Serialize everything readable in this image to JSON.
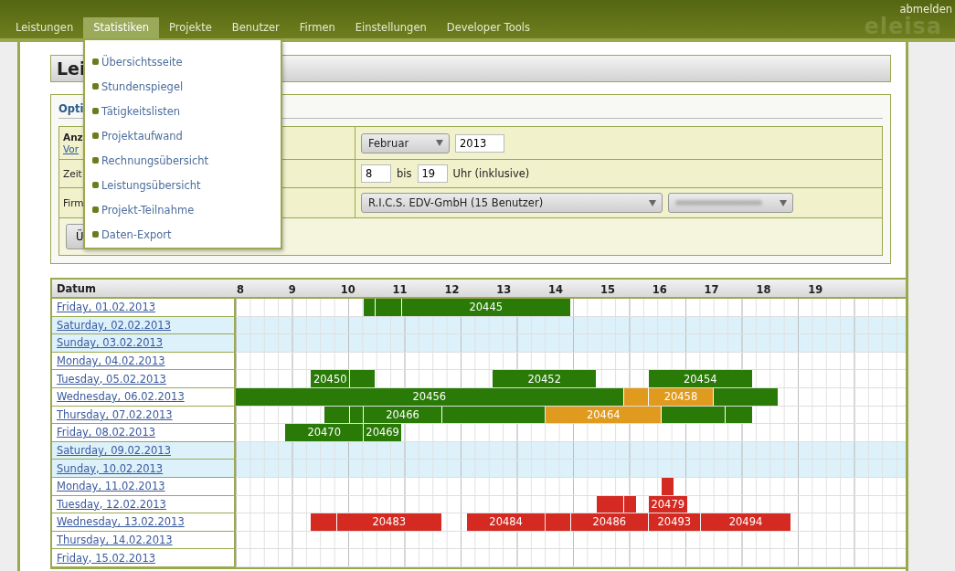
{
  "header": {
    "nav": [
      {
        "label": "Leistungen",
        "selected": false
      },
      {
        "label": "Statistiken",
        "selected": true
      },
      {
        "label": "Projekte",
        "selected": false
      },
      {
        "label": "Benutzer",
        "selected": false
      },
      {
        "label": "Firmen",
        "selected": false
      },
      {
        "label": "Einstellungen",
        "selected": false
      },
      {
        "label": "Developer Tools",
        "selected": false
      }
    ],
    "logout": "abmelden",
    "logo": "eleisa"
  },
  "menu": {
    "items": [
      "Übersichtsseite",
      "Stundenspiegel",
      "Tätigkeitslisten",
      "Projektaufwand",
      "Rechnungsübersicht",
      "Leistungsübersicht",
      "Projekt-Teilnahme",
      "Daten-Export"
    ]
  },
  "page_title": "Lei",
  "options": {
    "legend": "Opti",
    "rows": [
      {
        "kind": "month",
        "label": "Anz",
        "link": "Vor",
        "month": "Februar",
        "year": "2013"
      },
      {
        "kind": "hours",
        "label": "Zeit",
        "from": "8",
        "between": "bis",
        "to": "19",
        "suffix": "Uhr (inklusive)"
      },
      {
        "kind": "company",
        "label": "Firm",
        "company": "R.I.C.S. EDV-GmbH (15 Benutzer)"
      }
    ],
    "button": "Ü"
  },
  "timeline": {
    "date_column": "Datum",
    "hours": [
      "8",
      "9",
      "10",
      "11",
      "12",
      "13",
      "14",
      "15",
      "16",
      "17",
      "18",
      "19"
    ],
    "rows": [
      {
        "date": "Friday, 01.02.2013",
        "weekend": false,
        "bars": [
          {
            "color": "#2a7a08"
          },
          {
            "color": "#2a7a08"
          },
          {
            "color": "#2a7a08",
            "label": "20445"
          }
        ]
      },
      {
        "date": "Saturday, 02.02.2013",
        "weekend": true,
        "bars": []
      },
      {
        "date": "Sunday, 03.02.2013",
        "weekend": true,
        "bars": []
      },
      {
        "date": "Monday, 04.02.2013",
        "weekend": false,
        "bars": []
      },
      {
        "date": "Tuesday, 05.02.2013",
        "weekend": false,
        "bars": [
          {
            "color": "#2a7a08",
            "label": "20450"
          },
          {
            "color": "#2a7a08"
          },
          {
            "color": "#2a7a08",
            "label": "20452"
          },
          {
            "color": "#2a7a08",
            "label": "20454"
          }
        ]
      },
      {
        "date": "Wednesday, 06.02.2013",
        "weekend": false,
        "bars": [
          {
            "color": "#2a7a08",
            "label": "20456"
          },
          {
            "color": "#e09a1e"
          },
          {
            "color": "#e09a1e",
            "label": "20458"
          },
          {
            "color": "#2a7a08"
          }
        ]
      },
      {
        "date": "Thursday, 07.02.2013",
        "weekend": false,
        "bars": [
          {
            "color": "#2a7a08"
          },
          {
            "color": "#2a7a08"
          },
          {
            "color": "#2a7a08",
            "label": "20466"
          },
          {
            "color": "#2a7a08"
          },
          {
            "color": "#e09a1e",
            "label": "20464"
          },
          {
            "color": "#2a7a08"
          },
          {
            "color": "#2a7a08"
          }
        ]
      },
      {
        "date": "Friday, 08.02.2013",
        "weekend": false,
        "bars": [
          {
            "color": "#2a7a08",
            "label": "20470"
          },
          {
            "color": "#2a7a08",
            "label": "20469"
          }
        ]
      },
      {
        "date": "Saturday, 09.02.2013",
        "weekend": true,
        "bars": []
      },
      {
        "date": "Sunday, 10.02.2013",
        "weekend": true,
        "bars": []
      },
      {
        "date": "Monday, 11.02.2013",
        "weekend": false,
        "bars": [
          {
            "color": "#d42a22"
          }
        ]
      },
      {
        "date": "Tuesday, 12.02.2013",
        "weekend": false,
        "bars": [
          {
            "color": "#d42a22"
          },
          {
            "color": "#d42a22"
          },
          {
            "color": "#d42a22",
            "label": "20479"
          }
        ]
      },
      {
        "date": "Wednesday, 13.02.2013",
        "weekend": false,
        "bars": [
          {
            "color": "#d42a22"
          },
          {
            "color": "#d42a22",
            "label": "20483"
          },
          {
            "color": "#d42a22",
            "label": "20484"
          },
          {
            "color": "#d42a22"
          },
          {
            "color": "#d42a22",
            "label": "20486"
          },
          {
            "color": "#d42a22",
            "label": "20493"
          },
          {
            "color": "#d42a22",
            "label": "20494"
          }
        ]
      },
      {
        "date": "Thursday, 14.02.2013",
        "weekend": false,
        "bars": []
      },
      {
        "date": "Friday, 15.02.2013",
        "weekend": false,
        "bars": []
      }
    ]
  }
}
